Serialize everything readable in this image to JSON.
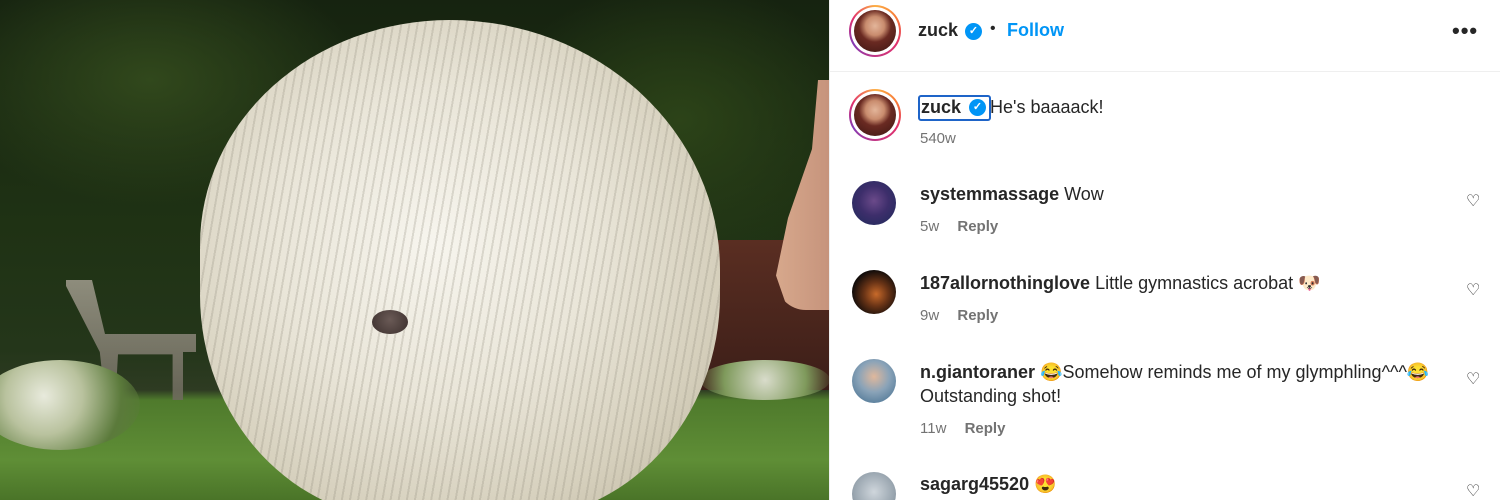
{
  "post": {
    "author": "zuck",
    "follow_label": "Follow",
    "more_icon": "more-horizontal-icon",
    "separator": "•",
    "verified_icon": "verified-badge-icon",
    "verified_glyph": "✓"
  },
  "caption": {
    "username": "zuck",
    "text": "He's baaaack!",
    "time": "540w"
  },
  "comments": [
    {
      "username": "systemmassage",
      "text": "Wow",
      "time": "5w",
      "reply_label": "Reply"
    },
    {
      "username": "187allornothinglove",
      "text": "Little gymnastics acrobat 🐶",
      "time": "9w",
      "reply_label": "Reply"
    },
    {
      "username": "n.giantoraner",
      "text": "😂Somehow reminds me of my glymphling^^^😂Outstanding shot!",
      "time": "11w",
      "reply_label": "Reply"
    },
    {
      "username": "sagarg45520",
      "text": "😍",
      "time": "",
      "reply_label": ""
    }
  ],
  "icons": {
    "heart": "♡",
    "more": "•••"
  },
  "colors": {
    "accent": "#0095f6",
    "text": "#262626",
    "secondary": "#737373"
  }
}
